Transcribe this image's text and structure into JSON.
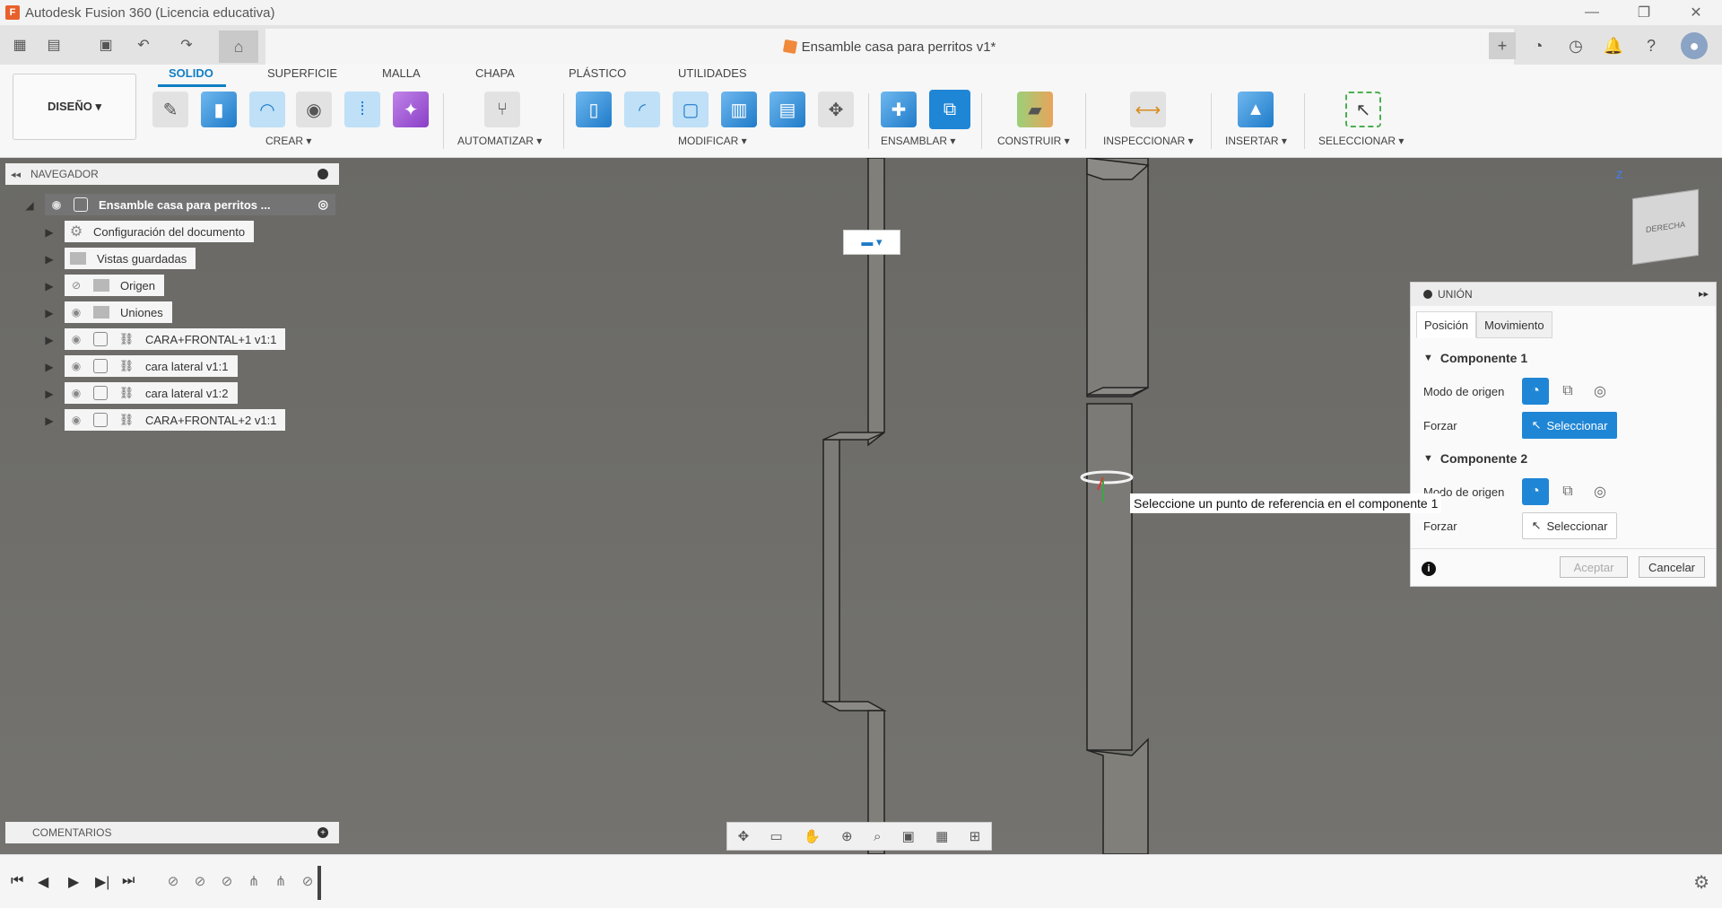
{
  "window": {
    "title": "Autodesk Fusion 360 (Licencia educativa)",
    "logo_letter": "F",
    "controls": [
      "—",
      "❐",
      "✕"
    ]
  },
  "quickbar": {
    "doc_title": "Ensamble casa para perritos v1*",
    "close": "✕"
  },
  "ribbon": {
    "design_label": "DISEÑO ▾",
    "tabs": [
      "SOLIDO",
      "SUPERFICIE",
      "MALLA",
      "CHAPA",
      "PLÁSTICO",
      "UTILIDADES"
    ],
    "groups": [
      "CREAR ▾",
      "AUTOMATIZAR ▾",
      "MODIFICAR ▾",
      "ENSAMBLAR ▾",
      "CONSTRUIR ▾",
      "INSPECCIONAR ▾",
      "INSERTAR ▾",
      "SELECCIONAR ▾"
    ]
  },
  "navigator": {
    "label": "NAVEGADOR",
    "root": "Ensamble casa para perritos ...",
    "items": [
      {
        "label": "Configuración del documento",
        "icon": "gear-icon"
      },
      {
        "label": "Vistas guardadas",
        "icon": "folder-icon"
      },
      {
        "label": "Origen",
        "icon": "folder-icon"
      },
      {
        "label": "Uniones",
        "icon": "folder-icon"
      },
      {
        "label": "CARA+FRONTAL+1 v1:1",
        "icon": "component-icon"
      },
      {
        "label": "cara lateral v1:1",
        "icon": "component-icon"
      },
      {
        "label": "cara lateral v1:2",
        "icon": "component-icon"
      },
      {
        "label": "CARA+FRONTAL+2 v1:1",
        "icon": "component-icon"
      }
    ]
  },
  "comments": {
    "label": "COMENTARIOS"
  },
  "viewcube": {
    "face": "DERECHA",
    "axis": "Z"
  },
  "union_dialog": {
    "title": "UNIÓN",
    "tabs": [
      "Posición",
      "Movimiento"
    ],
    "component1": {
      "title": "Componente 1",
      "mode_label": "Modo de origen",
      "force_label": "Forzar",
      "select_label": "Seleccionar"
    },
    "component2": {
      "title": "Componente 2",
      "mode_label": "Modo de origen",
      "force_label": "Forzar",
      "select_label": "Seleccionar"
    },
    "accept": "Aceptar",
    "cancel": "Cancelar",
    "info": "i"
  },
  "tooltip": "Seleccione un punto de referencia en el componente 1",
  "colors": {
    "accent": "#1f86d6",
    "viewport": "#6b6a66",
    "brand": "#e8612c"
  }
}
